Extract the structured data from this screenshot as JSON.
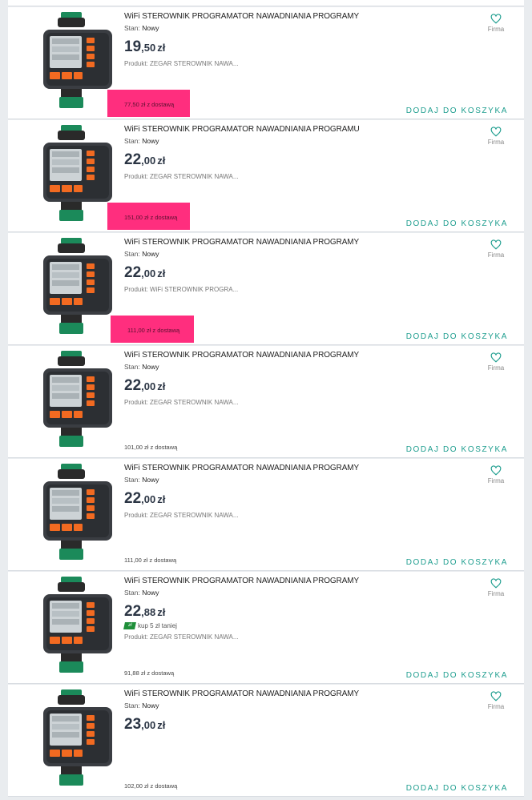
{
  "colors": {
    "accent": "#1f9e8f",
    "promo_bg": "#ff2e7e",
    "price": "#2b3544"
  },
  "listings": [
    {
      "title": "WiFi STEROWNIK PROGRAMATOR NAWADNIANIA PROGRAMY",
      "condition_label": "Stan:",
      "condition": "Nowy",
      "price_int": "19",
      "price_dec": ",50",
      "currency": "zł",
      "promo": "",
      "product": "Produkt: ZEGAR STEROWNIK NAWA...",
      "shipping": "77,50 zł z dostawą",
      "shipping_highlight": true,
      "add_label": "DODAJ DO KOSZYKA",
      "fav_label": "Firma",
      "fav_icon": "heart-outline-icon"
    },
    {
      "title": "WiFi STEROWNIK PROGRAMATOR NAWADNIANIA PROGRAMU",
      "condition_label": "Stan:",
      "condition": "Nowy",
      "price_int": "22",
      "price_dec": ",00",
      "currency": "zł",
      "promo": "",
      "product": "Produkt: ZEGAR STEROWNIK NAWA...",
      "shipping": "151,00 zł z dostawą",
      "shipping_highlight": true,
      "add_label": "DODAJ DO KOSZYKA",
      "fav_label": "Firma",
      "fav_icon": "heart-outline-icon"
    },
    {
      "title": "WiFi STEROWNIK PROGRAMATOR NAWADNIANIA PROGRAMY",
      "condition_label": "Stan:",
      "condition": "Nowy",
      "price_int": "22",
      "price_dec": ",00",
      "currency": "zł",
      "promo": "",
      "product": "Produkt: WiFi STEROWNIK PROGRA...",
      "shipping": "111,00 zł z dostawą",
      "shipping_highlight": true,
      "add_label": "DODAJ DO KOSZYKA",
      "fav_label": "Firma",
      "fav_icon": "heart-outline-icon"
    },
    {
      "title": "WiFi STEROWNIK PROGRAMATOR NAWADNIANIA PROGRAMY",
      "condition_label": "Stan:",
      "condition": "Nowy",
      "price_int": "22",
      "price_dec": ",00",
      "currency": "zł",
      "promo": "",
      "product": "Produkt: ZEGAR STEROWNIK NAWA...",
      "shipping": "101,00 zł z dostawą",
      "shipping_highlight": false,
      "add_label": "DODAJ DO KOSZYKA",
      "fav_label": "Firma",
      "fav_icon": "heart-outline-icon"
    },
    {
      "title": "WiFi STEROWNIK PROGRAMATOR NAWADNIANIA PROGRAMY",
      "condition_label": "Stan:",
      "condition": "Nowy",
      "price_int": "22",
      "price_dec": ",00",
      "currency": "zł",
      "promo": "",
      "product": "Produkt: ZEGAR STEROWNIK NAWA...",
      "shipping": "111,00 zł z dostawą",
      "shipping_highlight": false,
      "add_label": "DODAJ DO KOSZYKA",
      "fav_label": "Firma",
      "fav_icon": "heart-outline-icon"
    },
    {
      "title": "WiFi STEROWNIK PROGRAMATOR NAWADNIANIA PROGRAMY",
      "condition_label": "Stan:",
      "condition": "Nowy",
      "price_int": "22",
      "price_dec": ",88",
      "currency": "zł",
      "promo": "kup 5 zł taniej",
      "product": "Produkt: ZEGAR STEROWNIK NAWA...",
      "shipping": "91,88 zł z dostawą",
      "shipping_highlight": false,
      "add_label": "DODAJ DO KOSZYKA",
      "fav_label": "Firma",
      "fav_icon": "heart-outline-icon"
    },
    {
      "title": "WiFi STEROWNIK PROGRAMATOR NAWADNIANIA PROGRAMY",
      "condition_label": "Stan:",
      "condition": "Nowy",
      "price_int": "23",
      "price_dec": ",00",
      "currency": "zł",
      "promo": "",
      "product": "",
      "shipping": "102,00 zł z dostawą",
      "shipping_highlight": false,
      "add_label": "DODAJ DO KOSZYKA",
      "fav_label": "Firma",
      "fav_icon": "heart-outline-icon"
    }
  ]
}
